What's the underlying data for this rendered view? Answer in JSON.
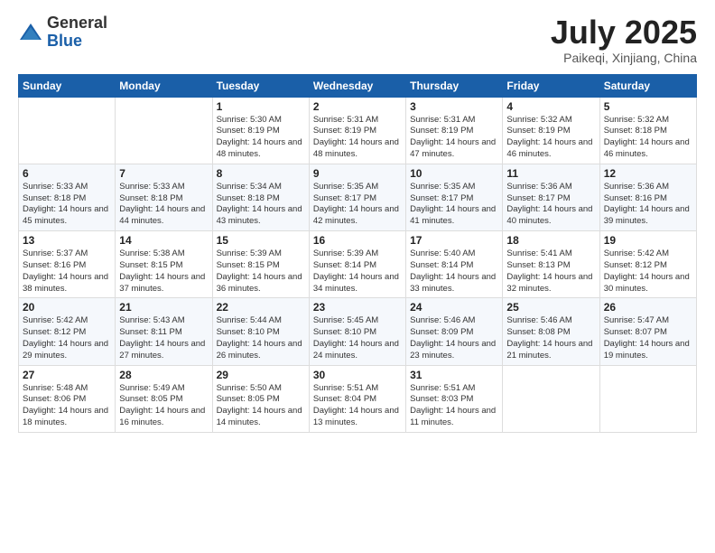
{
  "logo": {
    "general": "General",
    "blue": "Blue"
  },
  "header": {
    "month": "July 2025",
    "location": "Paikeqi, Xinjiang, China"
  },
  "days_of_week": [
    "Sunday",
    "Monday",
    "Tuesday",
    "Wednesday",
    "Thursday",
    "Friday",
    "Saturday"
  ],
  "weeks": [
    [
      {
        "day": "",
        "info": ""
      },
      {
        "day": "",
        "info": ""
      },
      {
        "day": "1",
        "info": "Sunrise: 5:30 AM\nSunset: 8:19 PM\nDaylight: 14 hours and 48 minutes."
      },
      {
        "day": "2",
        "info": "Sunrise: 5:31 AM\nSunset: 8:19 PM\nDaylight: 14 hours and 48 minutes."
      },
      {
        "day": "3",
        "info": "Sunrise: 5:31 AM\nSunset: 8:19 PM\nDaylight: 14 hours and 47 minutes."
      },
      {
        "day": "4",
        "info": "Sunrise: 5:32 AM\nSunset: 8:19 PM\nDaylight: 14 hours and 46 minutes."
      },
      {
        "day": "5",
        "info": "Sunrise: 5:32 AM\nSunset: 8:18 PM\nDaylight: 14 hours and 46 minutes."
      }
    ],
    [
      {
        "day": "6",
        "info": "Sunrise: 5:33 AM\nSunset: 8:18 PM\nDaylight: 14 hours and 45 minutes."
      },
      {
        "day": "7",
        "info": "Sunrise: 5:33 AM\nSunset: 8:18 PM\nDaylight: 14 hours and 44 minutes."
      },
      {
        "day": "8",
        "info": "Sunrise: 5:34 AM\nSunset: 8:18 PM\nDaylight: 14 hours and 43 minutes."
      },
      {
        "day": "9",
        "info": "Sunrise: 5:35 AM\nSunset: 8:17 PM\nDaylight: 14 hours and 42 minutes."
      },
      {
        "day": "10",
        "info": "Sunrise: 5:35 AM\nSunset: 8:17 PM\nDaylight: 14 hours and 41 minutes."
      },
      {
        "day": "11",
        "info": "Sunrise: 5:36 AM\nSunset: 8:17 PM\nDaylight: 14 hours and 40 minutes."
      },
      {
        "day": "12",
        "info": "Sunrise: 5:36 AM\nSunset: 8:16 PM\nDaylight: 14 hours and 39 minutes."
      }
    ],
    [
      {
        "day": "13",
        "info": "Sunrise: 5:37 AM\nSunset: 8:16 PM\nDaylight: 14 hours and 38 minutes."
      },
      {
        "day": "14",
        "info": "Sunrise: 5:38 AM\nSunset: 8:15 PM\nDaylight: 14 hours and 37 minutes."
      },
      {
        "day": "15",
        "info": "Sunrise: 5:39 AM\nSunset: 8:15 PM\nDaylight: 14 hours and 36 minutes."
      },
      {
        "day": "16",
        "info": "Sunrise: 5:39 AM\nSunset: 8:14 PM\nDaylight: 14 hours and 34 minutes."
      },
      {
        "day": "17",
        "info": "Sunrise: 5:40 AM\nSunset: 8:14 PM\nDaylight: 14 hours and 33 minutes."
      },
      {
        "day": "18",
        "info": "Sunrise: 5:41 AM\nSunset: 8:13 PM\nDaylight: 14 hours and 32 minutes."
      },
      {
        "day": "19",
        "info": "Sunrise: 5:42 AM\nSunset: 8:12 PM\nDaylight: 14 hours and 30 minutes."
      }
    ],
    [
      {
        "day": "20",
        "info": "Sunrise: 5:42 AM\nSunset: 8:12 PM\nDaylight: 14 hours and 29 minutes."
      },
      {
        "day": "21",
        "info": "Sunrise: 5:43 AM\nSunset: 8:11 PM\nDaylight: 14 hours and 27 minutes."
      },
      {
        "day": "22",
        "info": "Sunrise: 5:44 AM\nSunset: 8:10 PM\nDaylight: 14 hours and 26 minutes."
      },
      {
        "day": "23",
        "info": "Sunrise: 5:45 AM\nSunset: 8:10 PM\nDaylight: 14 hours and 24 minutes."
      },
      {
        "day": "24",
        "info": "Sunrise: 5:46 AM\nSunset: 8:09 PM\nDaylight: 14 hours and 23 minutes."
      },
      {
        "day": "25",
        "info": "Sunrise: 5:46 AM\nSunset: 8:08 PM\nDaylight: 14 hours and 21 minutes."
      },
      {
        "day": "26",
        "info": "Sunrise: 5:47 AM\nSunset: 8:07 PM\nDaylight: 14 hours and 19 minutes."
      }
    ],
    [
      {
        "day": "27",
        "info": "Sunrise: 5:48 AM\nSunset: 8:06 PM\nDaylight: 14 hours and 18 minutes."
      },
      {
        "day": "28",
        "info": "Sunrise: 5:49 AM\nSunset: 8:05 PM\nDaylight: 14 hours and 16 minutes."
      },
      {
        "day": "29",
        "info": "Sunrise: 5:50 AM\nSunset: 8:05 PM\nDaylight: 14 hours and 14 minutes."
      },
      {
        "day": "30",
        "info": "Sunrise: 5:51 AM\nSunset: 8:04 PM\nDaylight: 14 hours and 13 minutes."
      },
      {
        "day": "31",
        "info": "Sunrise: 5:51 AM\nSunset: 8:03 PM\nDaylight: 14 hours and 11 minutes."
      },
      {
        "day": "",
        "info": ""
      },
      {
        "day": "",
        "info": ""
      }
    ]
  ]
}
